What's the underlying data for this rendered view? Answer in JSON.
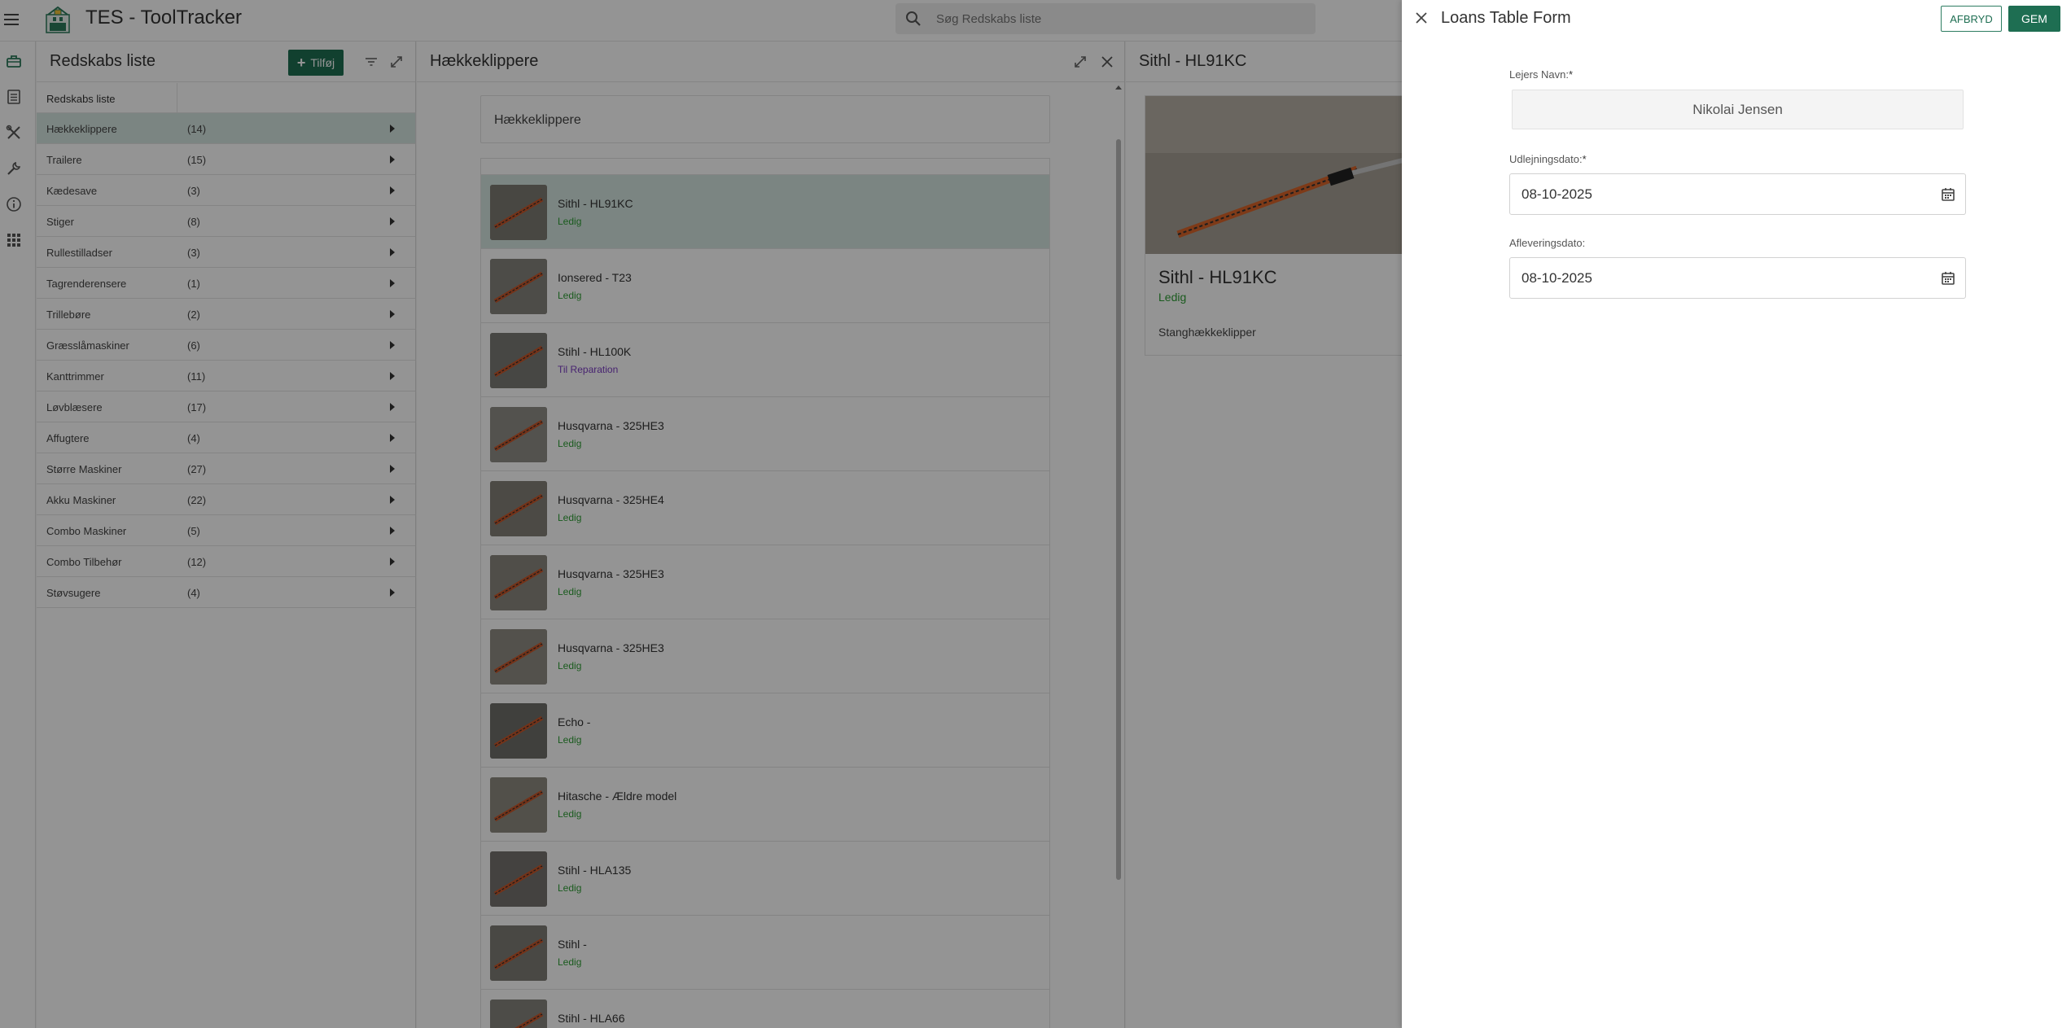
{
  "app": {
    "title": "TES - ToolTracker",
    "search_placeholder": "Søg Redskabs liste"
  },
  "rail": {
    "icons": [
      "toolbox-icon",
      "list-icon",
      "tools-icon",
      "wrench-icon",
      "info-icon",
      "apps-icon"
    ]
  },
  "categories": {
    "title": "Redskabs liste",
    "add_label": "Tilføj",
    "column_header": "Redskabs liste",
    "items": [
      {
        "name": "Hækkeklippere",
        "count": "(14)"
      },
      {
        "name": "Trailere",
        "count": "(15)"
      },
      {
        "name": "Kædesave",
        "count": "(3)"
      },
      {
        "name": "Stiger",
        "count": "(8)"
      },
      {
        "name": "Rullestilladser",
        "count": "(3)"
      },
      {
        "name": "Tagrenderensere",
        "count": "(1)"
      },
      {
        "name": "Trillebøre",
        "count": "(2)"
      },
      {
        "name": "Græsslåmaskiner",
        "count": "(6)"
      },
      {
        "name": "Kanttrimmer",
        "count": "(11)"
      },
      {
        "name": "Løvblæsere",
        "count": "(17)"
      },
      {
        "name": "Affugtere",
        "count": "(4)"
      },
      {
        "name": "Større Maskiner",
        "count": "(27)"
      },
      {
        "name": "Akku Maskiner",
        "count": "(22)"
      },
      {
        "name": "Combo Maskiner",
        "count": "(5)"
      },
      {
        "name": "Combo Tilbehør",
        "count": "(12)"
      },
      {
        "name": "Støvsugere",
        "count": "(4)"
      }
    ]
  },
  "tools": {
    "title": "Hækkeklippere",
    "filter_label": "Hækkeklippere",
    "items": [
      {
        "name": "Sithl - HL91KC",
        "status": "Ledig"
      },
      {
        "name": "Ionsered - T23",
        "status": "Ledig"
      },
      {
        "name": "Stihl - HL100K",
        "status": "Til Reparation"
      },
      {
        "name": "Husqvarna - 325HE3",
        "status": "Ledig"
      },
      {
        "name": "Husqvarna - 325HE4",
        "status": "Ledig"
      },
      {
        "name": "Husqvarna - 325HE3",
        "status": "Ledig"
      },
      {
        "name": "Husqvarna - 325HE3",
        "status": "Ledig"
      },
      {
        "name": "Echo -",
        "status": "Ledig"
      },
      {
        "name": "Hitasche - Ældre model",
        "status": "Ledig"
      },
      {
        "name": "Stihl - HLA135",
        "status": "Ledig"
      },
      {
        "name": "Stihl -",
        "status": "Ledig"
      },
      {
        "name": "Stihl - HLA66",
        "status": ""
      }
    ]
  },
  "detail": {
    "title": "Sithl - HL91KC",
    "name": "Sithl - HL91KC",
    "status": "Ledig",
    "description": "Stanghækkeklipper"
  },
  "drawer": {
    "title": "Loans Table Form",
    "cancel_label": "AFBRYD",
    "save_label": "GEM",
    "renter_label": "Lejers Navn:",
    "renter_value": "Nikolai Jensen",
    "loan_date_label": "Udlejningsdato:",
    "loan_date_value": "08-10-2025",
    "return_date_label": "Afleveringsdato:",
    "return_date_value": "08-10-2025",
    "required_mark": "*"
  },
  "colors": {
    "primary": "#1e6e52",
    "selected_row": "#d5e5e0",
    "status_available": "#2e9d34",
    "status_repair": "#7a3cc2"
  }
}
